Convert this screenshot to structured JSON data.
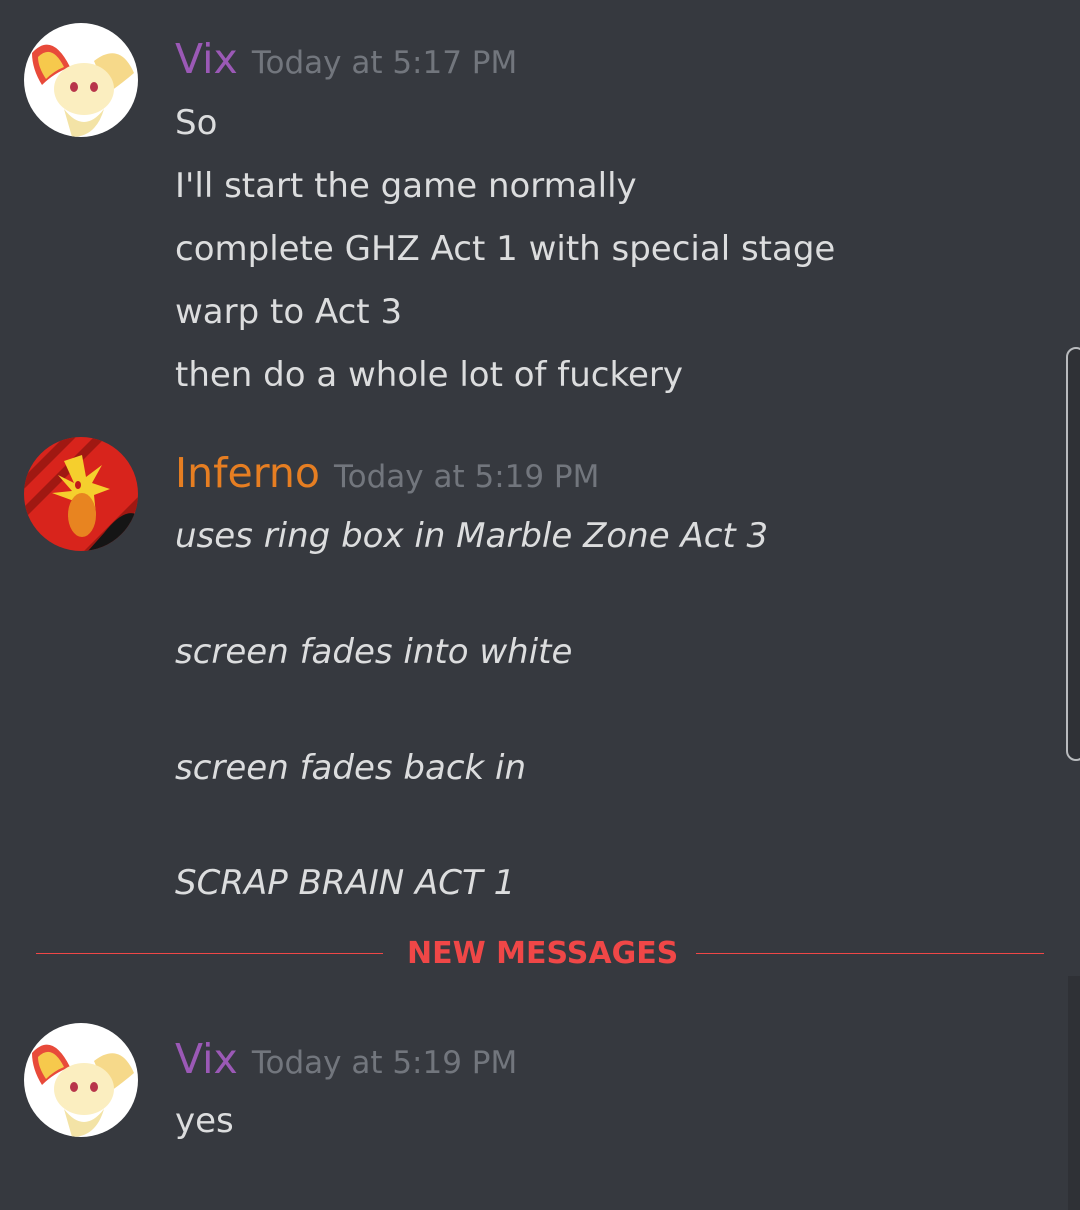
{
  "messages": [
    {
      "username": "Vix",
      "timestamp": "Today at 5:17 PM",
      "lines": [
        "So",
        "I'll start the game normally",
        "complete GHZ Act 1 with special stage",
        "warp to Act 3",
        "then do a whole lot of fuckery"
      ]
    },
    {
      "username": "Inferno",
      "timestamp": "Today at 5:19 PM",
      "lines": [
        "uses ring box in Marble Zone Act 3",
        "screen fades into white",
        "screen fades back in",
        "SCRAP BRAIN ACT 1"
      ]
    },
    {
      "username": "Vix",
      "timestamp": "Today at 5:19 PM",
      "lines": [
        "yes"
      ]
    }
  ],
  "divider": {
    "label": "NEW MESSAGES"
  },
  "colors": {
    "background": "#36393f",
    "vix_name": "#9b59b6",
    "inferno_name": "#e67e22",
    "new_messages": "#f04747"
  }
}
